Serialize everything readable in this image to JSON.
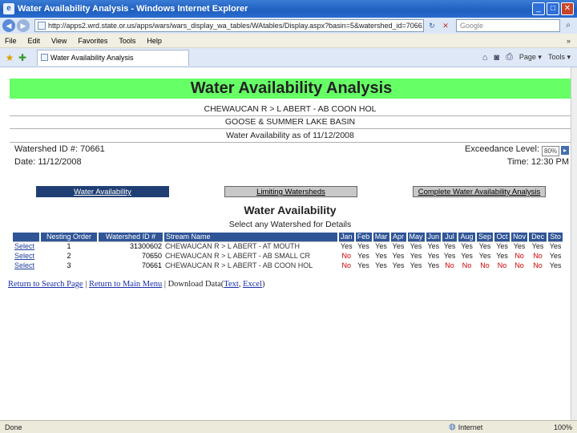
{
  "window": {
    "title": "Water Availability Analysis - Windows Internet Explorer",
    "minimize": "_",
    "maximize": "□",
    "close": "✕"
  },
  "address_bar": {
    "url": "http://apps2.wrd.state.or.us/apps/wars/wars_display_wa_tables/WAtables/Display.aspx?basin=5&watershed_id=70661",
    "search_placeholder": "Google"
  },
  "menu": {
    "items": [
      "File",
      "Edit",
      "View",
      "Favorites",
      "Tools",
      "Help"
    ]
  },
  "tab": {
    "label": "Water Availability Analysis"
  },
  "commands": {
    "page": "Page",
    "tools": "Tools"
  },
  "page": {
    "banner": "Water Availability Analysis",
    "subtitle_1": "CHEWAUCAN R > L ABERT - AB COON HOL",
    "subtitle_2": "GOOSE & SUMMER LAKE BASIN",
    "subtitle_3": "Water Availability as of 11/12/2008",
    "watershed_id": "Watershed ID #: 70661",
    "date": "Date: 11/12/2008",
    "exceedance_label": "Exceedance Level:",
    "exceedance_value": "80%",
    "time": "Time: 12:30 PM",
    "nav_tabs": [
      "Water Availability",
      "Limiting Watersheds",
      "Complete Water Availability Analysis"
    ],
    "section_title": "Water Availability",
    "section_subtitle": "Select any Watershed for Details"
  },
  "table": {
    "headers": [
      "",
      "Nesting Order",
      "Watershed ID #",
      "Stream Name",
      "Jan",
      "Feb",
      "Mar",
      "Apr",
      "May",
      "Jun",
      "Jul",
      "Aug",
      "Sep",
      "Oct",
      "Nov",
      "Dec",
      "Sto"
    ],
    "rows": [
      {
        "select": "Select",
        "order": "1",
        "id": "31300602",
        "name": "CHEWAUCAN R > L ABERT - AT MOUTH",
        "months": [
          "Yes",
          "Yes",
          "Yes",
          "Yes",
          "Yes",
          "Yes",
          "Yes",
          "Yes",
          "Yes",
          "Yes",
          "Yes",
          "Yes"
        ],
        "sto": "Yes"
      },
      {
        "select": "Select",
        "order": "2",
        "id": "70650",
        "name": "CHEWAUCAN R > L ABERT - AB SMALL CR",
        "months": [
          "No",
          "Yes",
          "Yes",
          "Yes",
          "Yes",
          "Yes",
          "Yes",
          "Yes",
          "Yes",
          "Yes",
          "No",
          "No"
        ],
        "sto": "Yes"
      },
      {
        "select": "Select",
        "order": "3",
        "id": "70661",
        "name": "CHEWAUCAN R > L ABERT - AB COON HOL",
        "months": [
          "No",
          "Yes",
          "Yes",
          "Yes",
          "Yes",
          "Yes",
          "No",
          "No",
          "No",
          "No",
          "No",
          "No"
        ],
        "sto": "Yes"
      }
    ]
  },
  "footer": {
    "return_search": "Return to Search Page",
    "sep1": " | ",
    "return_main": "Return to Main Menu",
    "sep2": " | Download Data(",
    "text": "Text",
    "comma": ", ",
    "excel": "Excel",
    "close_paren": ")"
  },
  "status": {
    "left": "Done",
    "zone": "Internet",
    "zoom": "100%"
  },
  "colors": {
    "banner": "#66ff66",
    "table_header": "#2f5597",
    "no_value": "#cc0000"
  }
}
